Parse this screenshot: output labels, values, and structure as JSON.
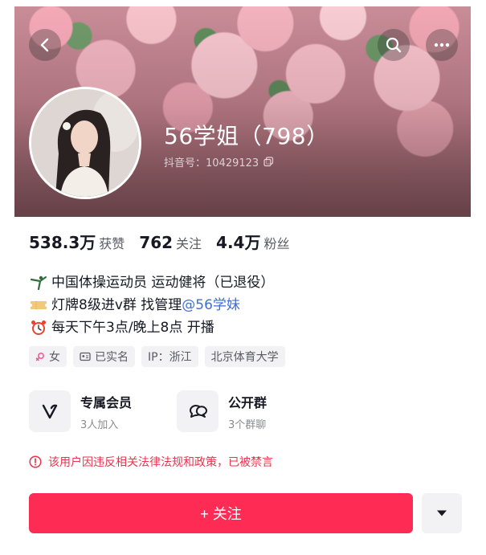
{
  "profile": {
    "display_name": "56学姐（798）",
    "douyin_id": "抖音号：10429123",
    "avatar_icon": "user-avatar"
  },
  "header": {
    "back_icon": "chevron-left-icon",
    "search_icon": "search-icon",
    "more_icon": "more-dots-icon"
  },
  "stats": [
    {
      "value": "538.3万",
      "label": "获赞"
    },
    {
      "value": "762",
      "label": "关注"
    },
    {
      "value": "4.4万",
      "label": "粉丝"
    }
  ],
  "bio": {
    "line1": "中国体操运动员 运动健将（已退役）",
    "line2_prefix": "灯牌8级进v群 找管理",
    "line2_mention": "@56学妹",
    "line3": "每天下午3点/晚上8点 开播"
  },
  "tags": [
    {
      "label": "女",
      "icon": "female-icon"
    },
    {
      "label": "已实名",
      "icon": "id-card-icon"
    },
    {
      "label": "IP：浙江",
      "icon": ""
    },
    {
      "label": "北京体育大学",
      "icon": ""
    }
  ],
  "cards": [
    {
      "title": "专属会员",
      "subtitle": "3人加入",
      "icon": "vip-v-icon"
    },
    {
      "title": "公开群",
      "subtitle": "3个群聊",
      "icon": "group-chat-icon"
    }
  ],
  "notice": {
    "text": "该用户因违反相关法律法规和政策，已被禁言",
    "icon": "warning-icon",
    "color": "#e8344c"
  },
  "actions": {
    "follow_label": "+ 关注",
    "follow_color": "#fe2c55",
    "dropdown_icon": "caret-down-icon"
  }
}
